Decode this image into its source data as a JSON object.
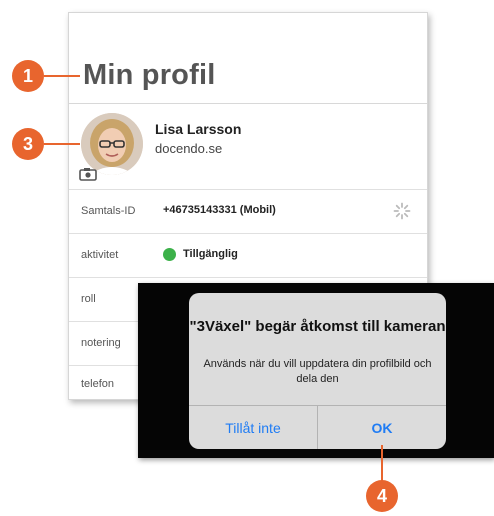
{
  "profile": {
    "title": "Min profil",
    "name": "Lisa Larsson",
    "org": "docendo.se",
    "rows": [
      {
        "label": "Samtals-ID",
        "value": "+46735143331 (Mobil)"
      },
      {
        "label": "aktivitet",
        "value": "Tillgänglig"
      },
      {
        "label": "roll",
        "value": ""
      },
      {
        "label": "notering",
        "value": ""
      },
      {
        "label": "telefon",
        "value": ""
      }
    ],
    "status_color": "#3cb14a"
  },
  "dialog": {
    "title": "\"3Växel\" begär åtkomst till kameran",
    "message": "Används när du vill uppdatera din profilbild och dela den",
    "deny_label": "Tillåt inte",
    "ok_label": "OK",
    "button_color": "#1f7cf4"
  },
  "callouts": [
    "1",
    "3",
    "4"
  ],
  "callout_color": "#e8652e"
}
